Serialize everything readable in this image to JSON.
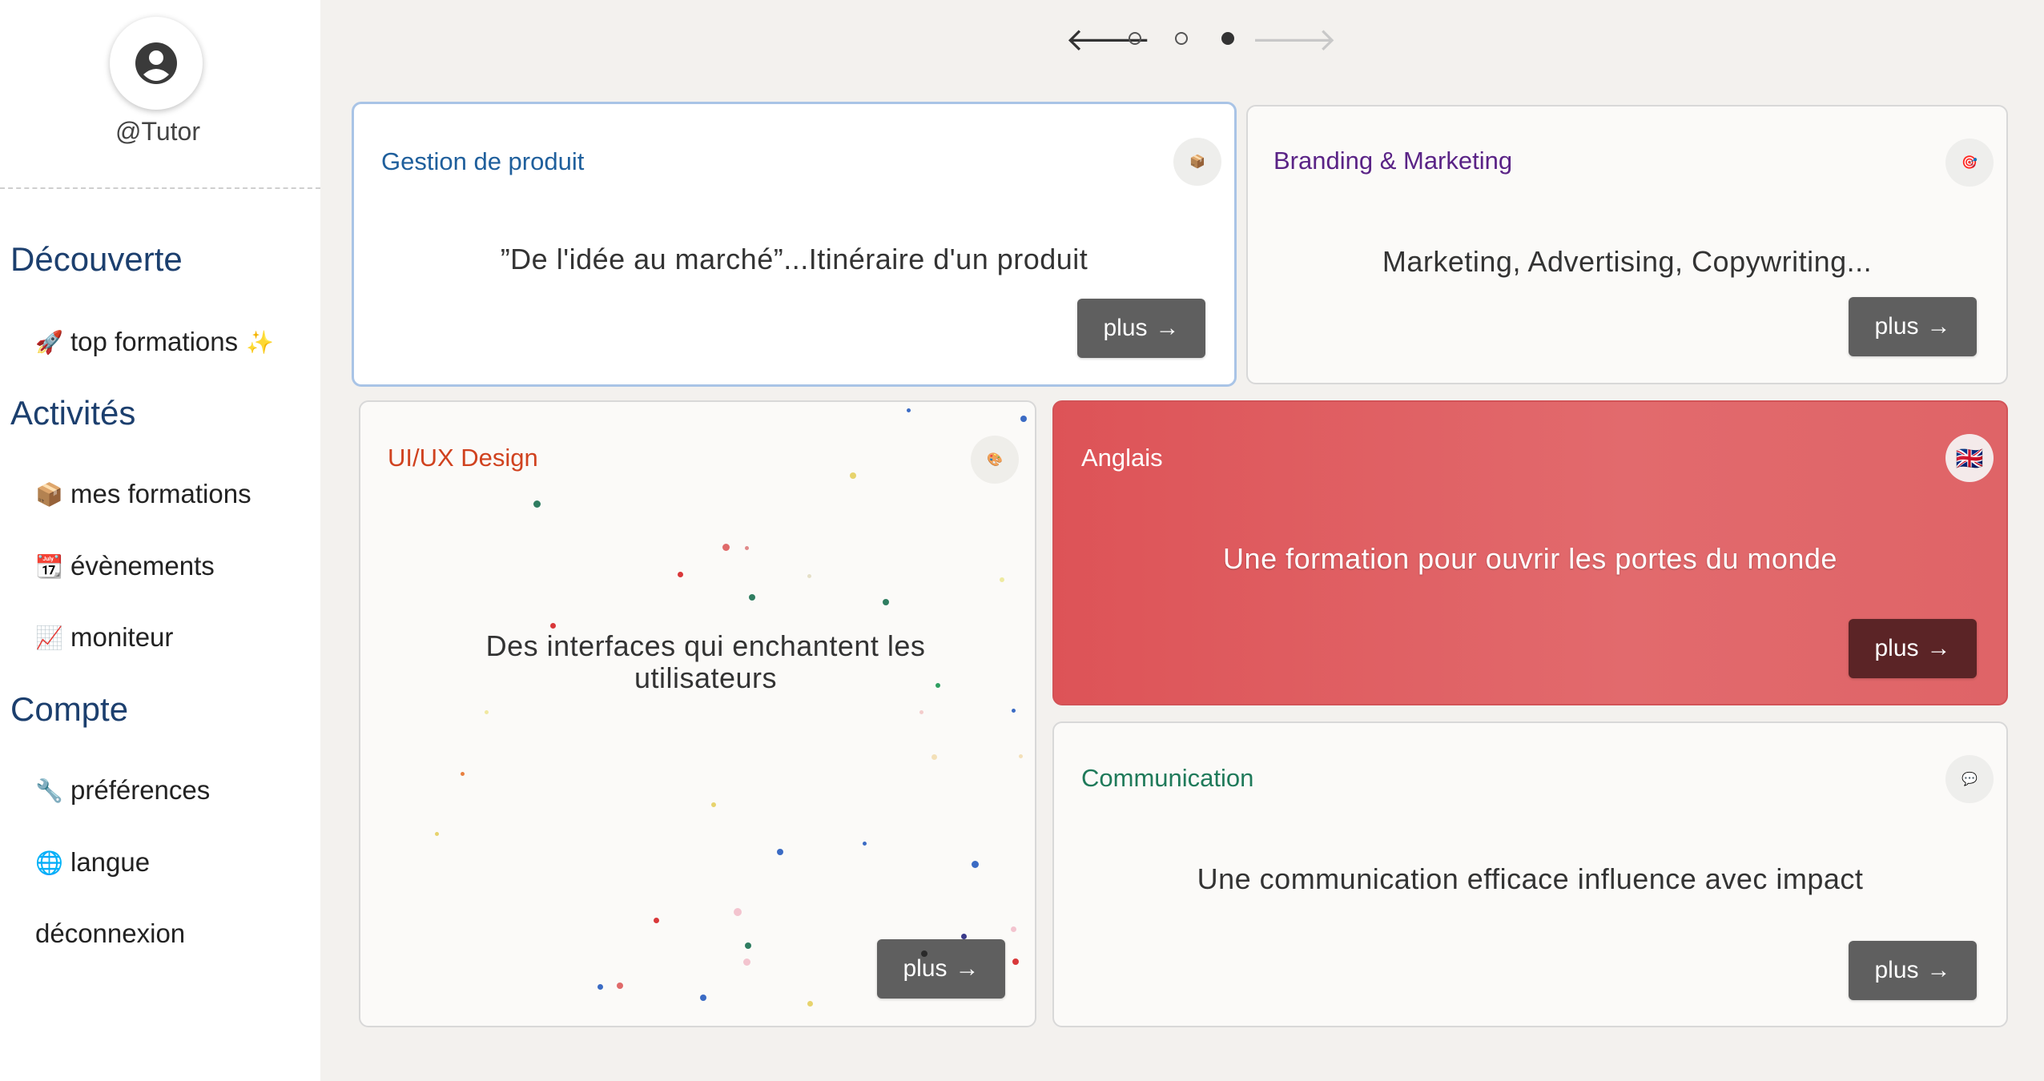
{
  "sidebar": {
    "username": "@Tutor",
    "sections": {
      "discover": "Découverte",
      "activities": "Activités",
      "account": "Compte"
    },
    "items": {
      "top": {
        "icon": "🚀",
        "label": "top formations",
        "sparkle": "✨"
      },
      "mes_formations": {
        "icon": "📦",
        "label": "mes formations"
      },
      "evenements": {
        "icon": "📆",
        "label": "évènements"
      },
      "moniteur": {
        "icon": "📈",
        "label": "moniteur"
      },
      "preferences": {
        "icon": "🔧",
        "label": "préférences"
      },
      "langue": {
        "icon": "🌐",
        "label": "langue"
      },
      "deconnexion": {
        "label": "déconnexion"
      }
    }
  },
  "pager": {
    "prev": "🡐",
    "next": "🡒",
    "current_page": 3,
    "total_pages": 3
  },
  "cards": {
    "gestion": {
      "title": "Gestion de produit",
      "title_color": "#1f5f9c",
      "icon": "📦",
      "description": "”De l'idée au marché”...Itinéraire d'un produit",
      "button": "plus"
    },
    "branding": {
      "title": "Branding & Marketing",
      "title_color": "#5a2386",
      "icon": "🎯",
      "description": "Marketing, Advertising, Copywriting...",
      "button": "plus"
    },
    "uiux": {
      "title": "UI/UX Design",
      "title_color": "#d0421f",
      "icon": "🎨",
      "description": "Des interfaces qui enchantent les utilisateurs",
      "button": "plus"
    },
    "anglais": {
      "title": "Anglais",
      "title_color": "#ffffff",
      "icon": "🇬🇧",
      "description": "Une formation pour ouvrir les portes du monde",
      "button": "plus"
    },
    "communication": {
      "title": "Communication",
      "title_color": "#1f7a5a",
      "icon": "💬",
      "description": "Une communication efficace influence avec impact",
      "button": "plus"
    }
  }
}
